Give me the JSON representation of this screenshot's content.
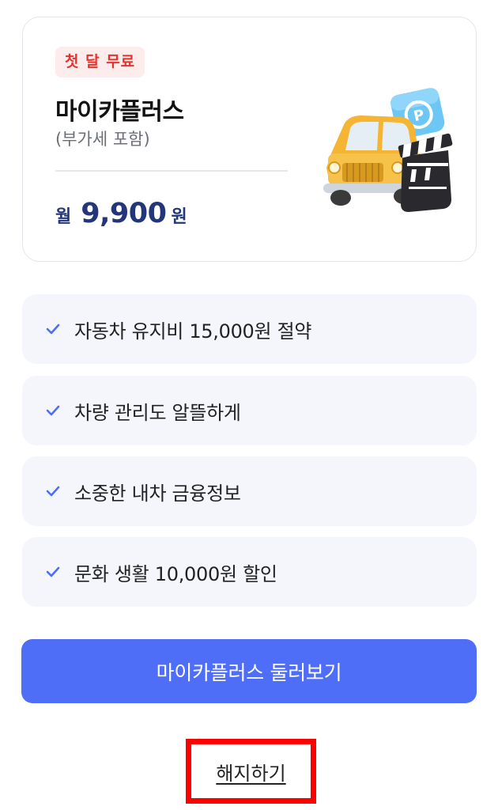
{
  "plan": {
    "badge": "첫 달 무료",
    "name": "마이카플러스",
    "vat_note": "(부가세 포함)",
    "price_prefix": "월",
    "price_amount": "9,900",
    "price_suffix": "원",
    "illustration": "car-clapperboard-parking-illustration"
  },
  "benefits": [
    {
      "icon": "check-icon",
      "text": "자동차 유지비 15,000원 절약"
    },
    {
      "icon": "check-icon",
      "text": "차량 관리도 알뜰하게"
    },
    {
      "icon": "check-icon",
      "text": "소중한 내차 금융정보"
    },
    {
      "icon": "check-icon",
      "text": "문화 생활 10,000원 할인"
    }
  ],
  "actions": {
    "browse_label": "마이카플러스 둘러보기",
    "cancel_label": "해지하기"
  },
  "colors": {
    "accent": "#4f6ef7",
    "price": "#23367a",
    "badge_text": "#e5322d",
    "badge_bg": "#fdecec",
    "check": "#4f6ef7",
    "highlight": "#ff0000"
  }
}
